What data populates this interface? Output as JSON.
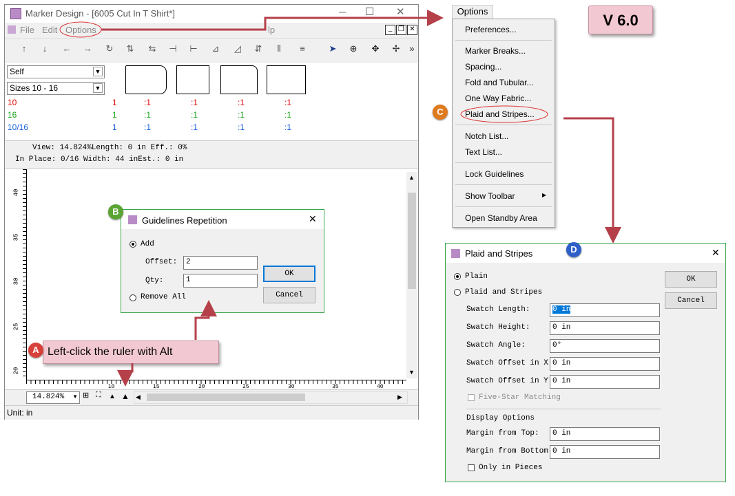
{
  "main_window": {
    "title": "Marker Design - [6005 Cut In T Shirt*]",
    "menu": [
      "File",
      "Edit",
      "Options",
      "lp"
    ],
    "dropdowns": [
      "Self",
      "Sizes 10 - 16"
    ],
    "sizes": [
      {
        "name": "10",
        "color": "#e00000",
        "qty": "1",
        "cells": [
          ":1",
          ":1",
          ":1",
          ":1"
        ]
      },
      {
        "name": "16",
        "color": "#1aa51a",
        "qty": "1",
        "cells": [
          ":1",
          ":1",
          ":1",
          ":1"
        ]
      },
      {
        "name": "10/16",
        "color": "#1a5fe0",
        "qty": "1",
        "cells": [
          ":1",
          ":1",
          ":1",
          ":1"
        ]
      }
    ],
    "info_line1": "View: 14.824%Length: 0 in Eff.: 0%",
    "info_line2": "In Place: 0/16    Width: 44 inEst.: 0 in",
    "ruler_v": [
      "40",
      "35",
      "30",
      "25",
      "20"
    ],
    "ruler_h": [
      "10",
      "15",
      "20",
      "25",
      "30",
      "35",
      "40"
    ],
    "zoom": "14.824%",
    "status": "Unit: in"
  },
  "guidelines_dialog": {
    "title": "Guidelines Repetition",
    "add_label": "Add",
    "offset_label": "Offset:",
    "offset_value": "2",
    "qty_label": "Qty:",
    "qty_value": "1",
    "remove_label": "Remove All",
    "ok": "OK",
    "cancel": "Cancel"
  },
  "options_menu": {
    "header": "Options",
    "items": [
      "Preferences...",
      "Marker Breaks...",
      "Spacing...",
      "Fold and Tubular...",
      "One Way Fabric...",
      "Plaid and Stripes...",
      "Notch List...",
      "Text List...",
      "Lock Guidelines",
      "Show Toolbar",
      "Open Standby Area"
    ]
  },
  "version_badge": "V 6.0",
  "plaid_dialog": {
    "title": "Plaid and Stripes",
    "plain_label": "Plain",
    "plaid_label": "Plaid and Stripes",
    "fields": [
      {
        "label": "Swatch Length:",
        "value": "0 in"
      },
      {
        "label": "Swatch Height:",
        "value": "0 in"
      },
      {
        "label": "Swatch Angle:",
        "value": "0°"
      },
      {
        "label": "Swatch Offset in X:",
        "value": "0 in"
      },
      {
        "label": "Swatch Offset in Y:",
        "value": "0 in"
      }
    ],
    "five_star": "Five-Star Matching",
    "display_options": "Display Options",
    "margin_top_label": "Margin from Top:",
    "margin_top_value": "0 in",
    "margin_bottom_label": "Margin from Bottom:",
    "margin_bottom_value": "0 in",
    "only_pieces": "Only in Pieces",
    "ok": "OK",
    "cancel": "Cancel"
  },
  "callout": "Left-click the ruler with Alt",
  "badges": {
    "a": "A",
    "b": "B",
    "c": "C",
    "d": "D"
  },
  "colors": {
    "arrow": "#b5404a",
    "green_border": "#3aa64a",
    "highlight": "#0078d7"
  }
}
